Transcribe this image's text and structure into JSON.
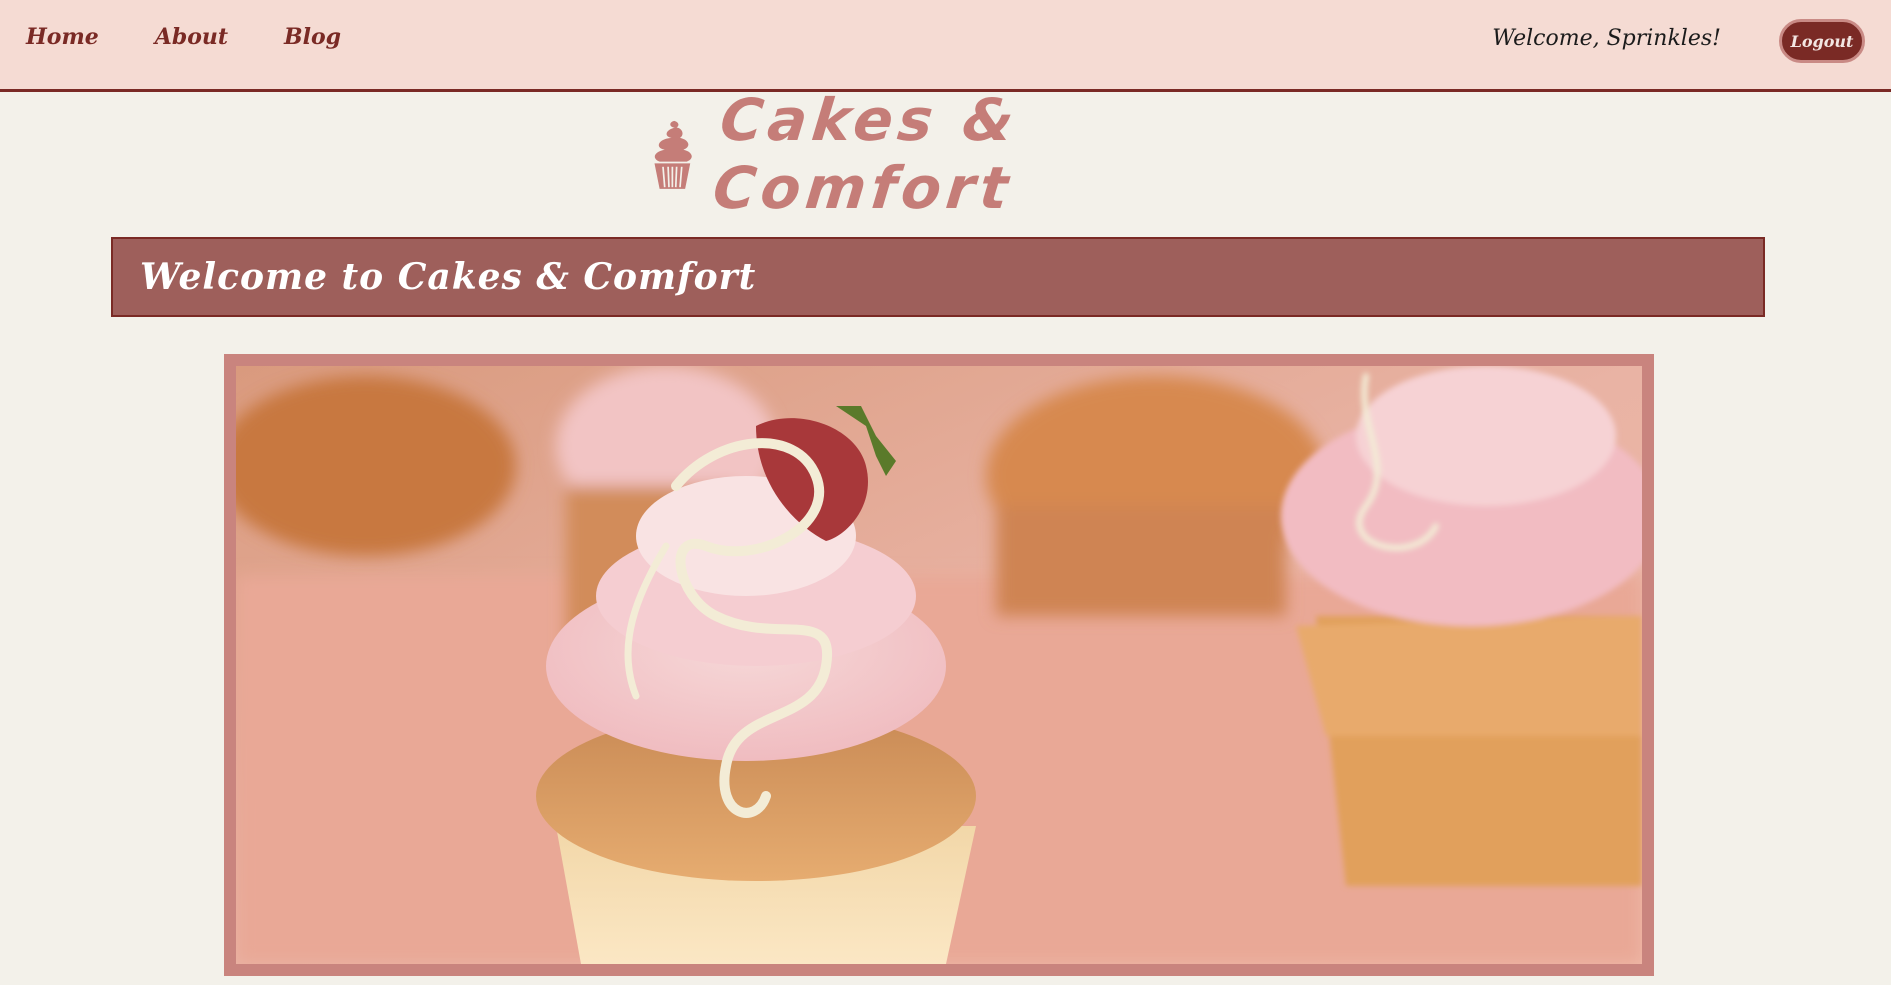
{
  "nav": {
    "links": [
      {
        "label": "Home"
      },
      {
        "label": "About"
      },
      {
        "label": "Blog"
      }
    ],
    "welcome_text": "Welcome, Sprinkles!",
    "logout_label": "Logout"
  },
  "logo": {
    "icon": "cupcake-icon",
    "text": "Cakes & Comfort"
  },
  "banner": {
    "title": "Welcome to Cakes & Comfort"
  },
  "hero": {
    "image": "cupcakes-photo"
  },
  "colors": {
    "nav_bg": "#f5dbd3",
    "accent": "#7a2a25",
    "banner_bg": "#9e5f5b",
    "logo": "#c57d78",
    "page_bg": "#f3f1ea"
  }
}
